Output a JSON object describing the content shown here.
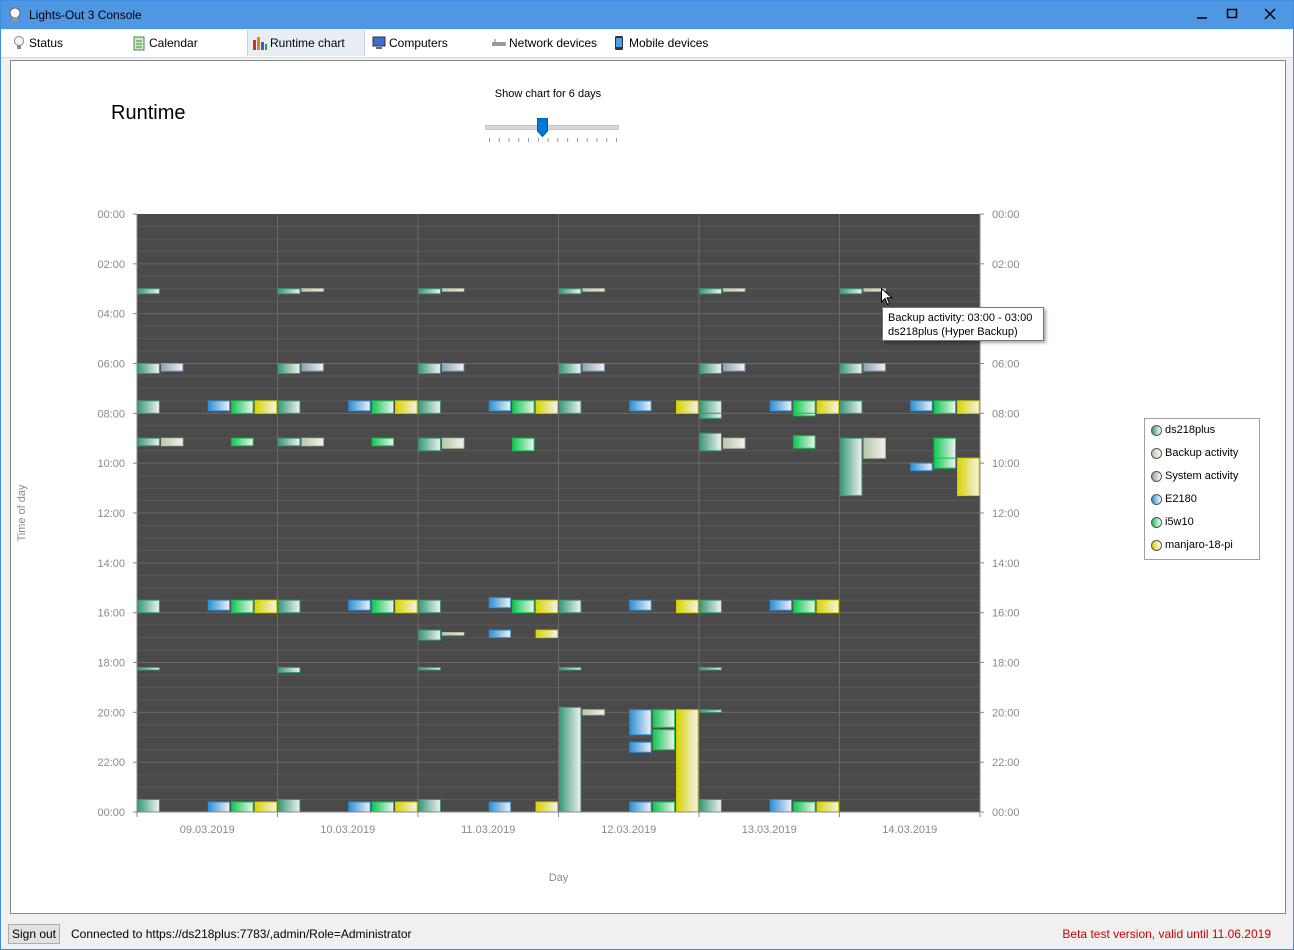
{
  "window": {
    "title": "Lights-Out 3 Console"
  },
  "tabs": [
    {
      "label": "Status",
      "icon": "bulb-icon"
    },
    {
      "label": "Calendar",
      "icon": "calendar-icon"
    },
    {
      "label": "Runtime chart",
      "icon": "bar-chart-icon",
      "active": true
    },
    {
      "label": "Computers",
      "icon": "computer-icon"
    },
    {
      "label": "Network devices",
      "icon": "network-device-icon"
    },
    {
      "label": "Mobile devices",
      "icon": "mobile-icon"
    }
  ],
  "page": {
    "title": "Runtime",
    "slider": {
      "label": "Show chart for 6 days",
      "value": 6,
      "min": 1,
      "max": 14
    }
  },
  "tooltip": {
    "line1": "Backup activity: 03:00 - 03:00",
    "line2": "ds218plus (Hyper Backup)"
  },
  "legend": [
    {
      "name": "ds218plus",
      "color": "#3a9a7a"
    },
    {
      "name": "Backup activity",
      "color": "#b7c9a7"
    },
    {
      "name": "System activity",
      "color": "#8aa2b6"
    },
    {
      "name": "E2180",
      "color": "#2d8fd6"
    },
    {
      "name": "i5w10",
      "color": "#10c850"
    },
    {
      "name": "manjaro-18-pi",
      "color": "#d8d400"
    }
  ],
  "statusbar": {
    "signout_label": "Sign out",
    "connected": "Connected to https://ds218plus:7783/,admin/Role=Administrator",
    "beta": "Beta test version, valid until 11.06.2019"
  },
  "chart_data": {
    "type": "bar",
    "xlabel": "Day",
    "ylabel": "Time of day",
    "categories": [
      "09.03.2019",
      "10.03.2019",
      "11.03.2019",
      "12.03.2019",
      "13.03.2019",
      "14.03.2019"
    ],
    "y_ticks": [
      "00:00",
      "02:00",
      "04:00",
      "06:00",
      "08:00",
      "10:00",
      "12:00",
      "14:00",
      "16:00",
      "18:00",
      "20:00",
      "22:00",
      "00:00"
    ],
    "ylim": [
      0,
      24
    ],
    "grid": true,
    "legend_position": "right",
    "series": [
      {
        "name": "ds218plus",
        "color": "#3a9a7a",
        "slot": 0,
        "intervals": [
          [
            0,
            3.0,
            3.2
          ],
          [
            0,
            6.0,
            6.4
          ],
          [
            0,
            7.5,
            8.0
          ],
          [
            0,
            9.0,
            9.3
          ],
          [
            0,
            15.5,
            16.0
          ],
          [
            0,
            18.2,
            18.3
          ],
          [
            0,
            23.5,
            24.0
          ],
          [
            1,
            3.0,
            3.2
          ],
          [
            1,
            6.0,
            6.4
          ],
          [
            1,
            7.5,
            8.0
          ],
          [
            1,
            9.0,
            9.3
          ],
          [
            1,
            15.5,
            16.0
          ],
          [
            1,
            18.2,
            18.4
          ],
          [
            1,
            23.5,
            24.0
          ],
          [
            2,
            3.0,
            3.2
          ],
          [
            2,
            6.0,
            6.4
          ],
          [
            2,
            7.5,
            8.0
          ],
          [
            2,
            9.0,
            9.5
          ],
          [
            2,
            15.5,
            16.0
          ],
          [
            2,
            16.7,
            17.1
          ],
          [
            2,
            18.2,
            18.3
          ],
          [
            2,
            23.5,
            24.0
          ],
          [
            3,
            3.0,
            3.2
          ],
          [
            3,
            6.0,
            6.4
          ],
          [
            3,
            7.5,
            8.0
          ],
          [
            3,
            15.5,
            16.0
          ],
          [
            3,
            18.2,
            18.3
          ],
          [
            3,
            19.8,
            24.0
          ],
          [
            4,
            3.0,
            3.2
          ],
          [
            4,
            6.0,
            6.4
          ],
          [
            4,
            7.5,
            8.0
          ],
          [
            4,
            8.0,
            8.2
          ],
          [
            4,
            8.8,
            9.5
          ],
          [
            4,
            15.5,
            16.0
          ],
          [
            4,
            18.2,
            18.3
          ],
          [
            4,
            19.9,
            20.0
          ],
          [
            4,
            23.5,
            24.0
          ],
          [
            5,
            3.0,
            3.2
          ],
          [
            5,
            6.0,
            6.4
          ],
          [
            5,
            7.5,
            8.0
          ],
          [
            5,
            9.0,
            11.3
          ]
        ]
      },
      {
        "name": "Backup activity",
        "color": "#b7c9a7",
        "slot": 1,
        "intervals": [
          [
            0,
            9.0,
            9.3
          ],
          [
            1,
            3.0,
            3.1
          ],
          [
            1,
            9.0,
            9.3
          ],
          [
            2,
            3.0,
            3.1
          ],
          [
            2,
            9.0,
            9.4
          ],
          [
            2,
            16.8,
            16.9
          ],
          [
            3,
            3.0,
            3.1
          ],
          [
            3,
            19.9,
            20.1
          ],
          [
            4,
            3.0,
            3.1
          ],
          [
            4,
            9.0,
            9.4
          ],
          [
            5,
            3.0,
            3.1
          ],
          [
            5,
            9.0,
            9.8
          ]
        ]
      },
      {
        "name": "System activity",
        "color": "#8aa2b6",
        "slot": 1,
        "intervals": [
          [
            0,
            6.0,
            6.3
          ],
          [
            1,
            6.0,
            6.3
          ],
          [
            2,
            6.0,
            6.3
          ],
          [
            3,
            6.0,
            6.3
          ],
          [
            4,
            6.0,
            6.3
          ],
          [
            5,
            6.0,
            6.3
          ]
        ]
      },
      {
        "name": "E2180",
        "color": "#2d8fd6",
        "slot": 3,
        "intervals": [
          [
            0,
            7.5,
            7.9
          ],
          [
            0,
            15.5,
            15.9
          ],
          [
            0,
            23.6,
            24.0
          ],
          [
            1,
            7.5,
            7.9
          ],
          [
            1,
            15.5,
            15.9
          ],
          [
            1,
            23.6,
            24.0
          ],
          [
            2,
            7.5,
            7.9
          ],
          [
            2,
            15.4,
            15.8
          ],
          [
            2,
            16.7,
            17.0
          ],
          [
            2,
            23.6,
            24.0
          ],
          [
            3,
            7.5,
            7.9
          ],
          [
            3,
            15.5,
            15.9
          ],
          [
            3,
            19.9,
            20.9
          ],
          [
            3,
            21.2,
            21.6
          ],
          [
            3,
            23.6,
            24.0
          ],
          [
            4,
            7.5,
            7.9
          ],
          [
            4,
            15.5,
            15.9
          ],
          [
            4,
            23.5,
            24.0
          ],
          [
            5,
            7.5,
            7.9
          ],
          [
            5,
            10.0,
            10.3
          ]
        ]
      },
      {
        "name": "i5w10",
        "color": "#10c850",
        "slot": 4,
        "intervals": [
          [
            0,
            7.5,
            8.0
          ],
          [
            0,
            9.0,
            9.3
          ],
          [
            0,
            15.5,
            16.0
          ],
          [
            0,
            23.6,
            24.0
          ],
          [
            1,
            7.5,
            8.0
          ],
          [
            1,
            9.0,
            9.3
          ],
          [
            1,
            15.5,
            16.0
          ],
          [
            1,
            23.6,
            24.0
          ],
          [
            2,
            7.5,
            8.0
          ],
          [
            2,
            9.0,
            9.5
          ],
          [
            2,
            15.5,
            16.0
          ],
          [
            3,
            19.9,
            20.6
          ],
          [
            3,
            20.7,
            21.5
          ],
          [
            3,
            23.6,
            24.0
          ],
          [
            4,
            7.5,
            8.0
          ],
          [
            4,
            8.0,
            8.1
          ],
          [
            4,
            8.9,
            9.4
          ],
          [
            4,
            15.5,
            16.0
          ],
          [
            4,
            23.6,
            24.0
          ],
          [
            5,
            7.5,
            8.0
          ],
          [
            5,
            9.0,
            9.8
          ],
          [
            5,
            9.8,
            10.2
          ]
        ]
      },
      {
        "name": "manjaro-18-pi",
        "color": "#d8d400",
        "slot": 5,
        "intervals": [
          [
            0,
            7.5,
            8.0
          ],
          [
            0,
            15.5,
            16.0
          ],
          [
            0,
            23.6,
            24.0
          ],
          [
            1,
            7.5,
            8.0
          ],
          [
            1,
            15.5,
            16.0
          ],
          [
            1,
            23.6,
            24.0
          ],
          [
            2,
            7.5,
            8.0
          ],
          [
            2,
            15.5,
            16.0
          ],
          [
            2,
            16.7,
            17.0
          ],
          [
            2,
            23.6,
            24.0
          ],
          [
            3,
            7.5,
            8.0
          ],
          [
            3,
            15.5,
            16.0
          ],
          [
            3,
            19.9,
            24.0
          ],
          [
            4,
            7.5,
            8.0
          ],
          [
            4,
            15.5,
            16.0
          ],
          [
            4,
            23.6,
            24.0
          ],
          [
            5,
            7.5,
            8.0
          ],
          [
            5,
            9.8,
            11.3
          ]
        ]
      }
    ]
  }
}
